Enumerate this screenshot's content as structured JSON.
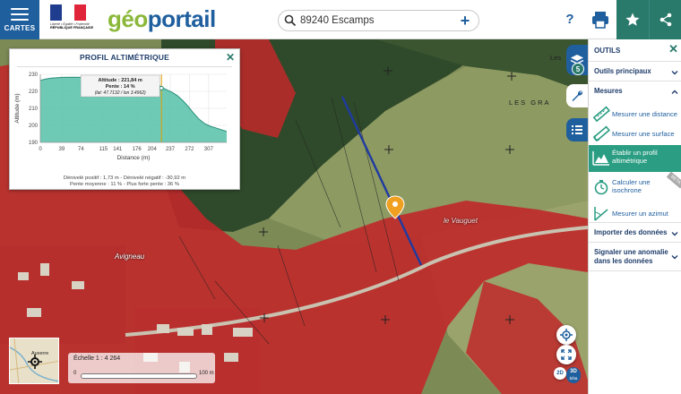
{
  "header": {
    "menu_label": "CARTES",
    "logo_geo": "géo",
    "logo_portail": "portail",
    "gov_motto": "Liberté • Égalité • Fraternité",
    "gov_name": "RÉPUBLIQUE FRANÇAISE",
    "search_value": "89240 Escamps",
    "help_label": "?",
    "colors": {
      "primary": "#1f5f9e",
      "accent": "#2a7a6c",
      "logo_green": "#8bb83a"
    },
    "icons": [
      "menu-icon",
      "search-icon",
      "plus-icon",
      "print-icon",
      "star-icon",
      "share-icon"
    ]
  },
  "profile": {
    "title": "PROFIL ALTIMÉTRIQUE",
    "tooltip_alt": "Altitude : 221,84 m",
    "tooltip_slope": "Pente : 14 %",
    "tooltip_coords": "(lat: 47.7132 / lon 3.4962)",
    "stats_line1": "Dénivelé positif : 1,73 m - Dénivelé négatif : -30,92 m",
    "stats_line2": "Pente moyenne : 11 % - Plus forte pente : 36 %"
  },
  "chart_data": {
    "type": "area",
    "xlabel": "Distance (m)",
    "ylabel": "Altitude (m)",
    "ylim": [
      190,
      230
    ],
    "yticks": [
      190,
      200,
      210,
      220,
      230
    ],
    "xticks": [
      0,
      39,
      74,
      115,
      141,
      176,
      204,
      237,
      272,
      307
    ],
    "xlim": [
      0,
      340
    ],
    "grid": true,
    "fill_color": "#5ec3ad",
    "series": [
      {
        "x": [
          0,
          10,
          20,
          40,
          60,
          80,
          100,
          120,
          140,
          160,
          180,
          190,
          200,
          215,
          225,
          230,
          240,
          250,
          260,
          270,
          280,
          290,
          300,
          310,
          320,
          330,
          340
        ],
        "y": [
          226.5,
          227.2,
          227.8,
          228.2,
          228.3,
          228.2,
          228.0,
          227.8,
          227.6,
          227.3,
          227.0,
          226.6,
          226.0,
          224.0,
          221.8,
          221.0,
          219.5,
          217.5,
          214.5,
          211.0,
          207.0,
          203.5,
          201.0,
          199.5,
          198.5,
          197.5,
          196.5
        ]
      }
    ],
    "highlight_x": 221
  },
  "map": {
    "place_avigneau": "Avigneau",
    "place_vauguet": "le Vauguet",
    "lieu_dit": "LES GRA",
    "lieu_dit_2": "Les",
    "overview_town": "Auxerre",
    "scale_label": "Échelle 1 : 4 264",
    "scale_min": "0",
    "scale_max": "100 m",
    "layers_count": "5",
    "view_2d": "2D",
    "view_3d": "3D",
    "view_3d_sub": "bêta",
    "colors": {
      "flood_zone": "#d42a2a",
      "profile_line": "#1f3aa0",
      "marker": "#f0a020"
    }
  },
  "tools": {
    "title": "OUTILS",
    "sections": {
      "principal": "Outils principaux",
      "mesures": "Mesures",
      "importer": "Importer des données",
      "signaler": "Signaler une anomalie dans les données"
    },
    "items": [
      {
        "label": "Mesurer une distance",
        "icon": "ruler-icon"
      },
      {
        "label": "Mesurer une surface",
        "icon": "area-ruler-icon"
      },
      {
        "label": "Établir un profil altimétrique",
        "icon": "elevation-profile-icon"
      },
      {
        "label": "Calculer une isochrone",
        "icon": "isochrone-icon"
      },
      {
        "label": "Mesurer un azimut",
        "icon": "azimuth-icon"
      }
    ],
    "beta_label": "BETA"
  }
}
